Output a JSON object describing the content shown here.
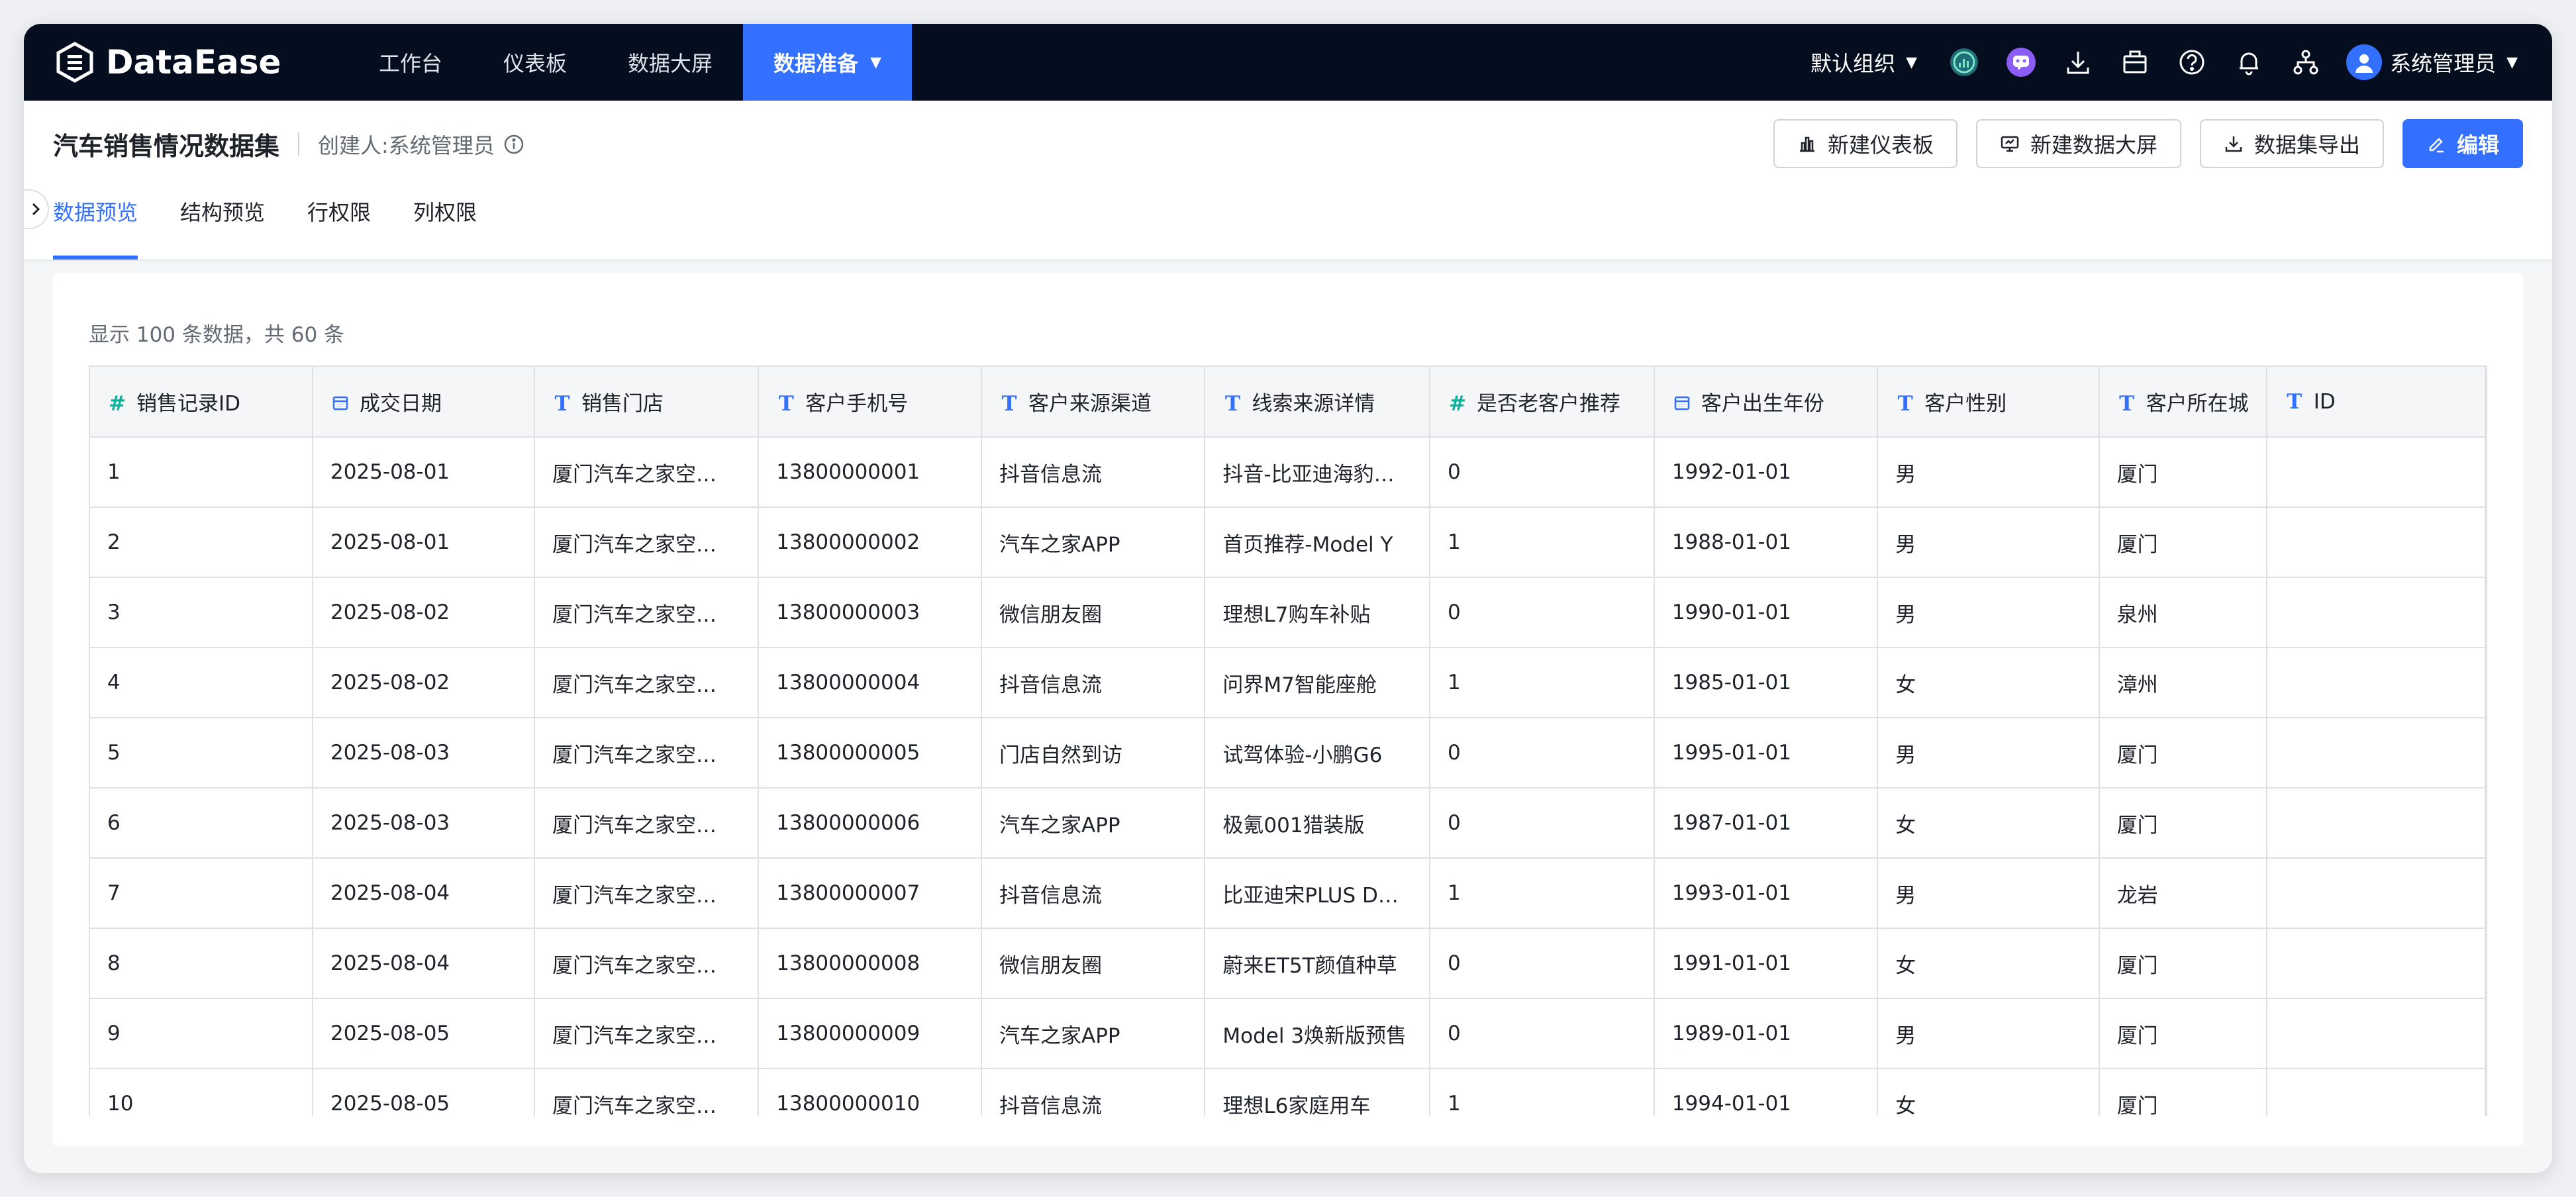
{
  "app": {
    "name": "DataEase"
  },
  "nav": {
    "items": [
      "工作台",
      "仪表板",
      "数据大屏"
    ],
    "active": "数据准备"
  },
  "topbar": {
    "org": "默认组织",
    "user": "系统管理员"
  },
  "header": {
    "title": "汽车销售情况数据集",
    "creator": "创建人:系统管理员",
    "actions": {
      "new_dashboard": "新建仪表板",
      "new_screen": "新建数据大屏",
      "export": "数据集导出",
      "edit": "编辑"
    },
    "tabs": [
      "数据预览",
      "结构预览",
      "行权限",
      "列权限"
    ]
  },
  "preview": {
    "count_text": "显示 100 条数据，共 60 条"
  },
  "table": {
    "columns": [
      {
        "label": "销售记录ID",
        "type": "number"
      },
      {
        "label": "成交日期",
        "type": "date"
      },
      {
        "label": "销售门店",
        "type": "text"
      },
      {
        "label": "客户手机号",
        "type": "text"
      },
      {
        "label": "客户来源渠道",
        "type": "text"
      },
      {
        "label": "线索来源详情",
        "type": "text"
      },
      {
        "label": "是否老客户推荐",
        "type": "number"
      },
      {
        "label": "客户出生年份",
        "type": "date"
      },
      {
        "label": "客户性别",
        "type": "text"
      },
      {
        "label": "客户所在城",
        "type": "text"
      },
      {
        "label": "ID",
        "type": "text"
      }
    ],
    "rows": [
      [
        "1",
        "2025-08-01",
        "厦门汽车之家空…",
        "13800000001",
        "抖音信息流",
        "抖音-比亚迪海豹…",
        "0",
        "1992-01-01",
        "男",
        "厦门",
        ""
      ],
      [
        "2",
        "2025-08-01",
        "厦门汽车之家空…",
        "13800000002",
        "汽车之家APP",
        "首页推荐-Model Y",
        "1",
        "1988-01-01",
        "男",
        "厦门",
        ""
      ],
      [
        "3",
        "2025-08-02",
        "厦门汽车之家空…",
        "13800000003",
        "微信朋友圈",
        "理想L7购车补贴",
        "0",
        "1990-01-01",
        "男",
        "泉州",
        ""
      ],
      [
        "4",
        "2025-08-02",
        "厦门汽车之家空…",
        "13800000004",
        "抖音信息流",
        "问界M7智能座舱",
        "1",
        "1985-01-01",
        "女",
        "漳州",
        ""
      ],
      [
        "5",
        "2025-08-03",
        "厦门汽车之家空…",
        "13800000005",
        "门店自然到访",
        "试驾体验-小鹏G6",
        "0",
        "1995-01-01",
        "男",
        "厦门",
        ""
      ],
      [
        "6",
        "2025-08-03",
        "厦门汽车之家空…",
        "13800000006",
        "汽车之家APP",
        "极氪001猎装版",
        "0",
        "1987-01-01",
        "女",
        "厦门",
        ""
      ],
      [
        "7",
        "2025-08-04",
        "厦门汽车之家空…",
        "13800000007",
        "抖音信息流",
        "比亚迪宋PLUS D…",
        "1",
        "1993-01-01",
        "男",
        "龙岩",
        ""
      ],
      [
        "8",
        "2025-08-04",
        "厦门汽车之家空…",
        "13800000008",
        "微信朋友圈",
        "蔚来ET5T颜值种草",
        "0",
        "1991-01-01",
        "女",
        "厦门",
        ""
      ],
      [
        "9",
        "2025-08-05",
        "厦门汽车之家空…",
        "13800000009",
        "汽车之家APP",
        "Model 3焕新版预售",
        "0",
        "1989-01-01",
        "男",
        "厦门",
        ""
      ],
      [
        "10",
        "2025-08-05",
        "厦门汽车之家空…",
        "13800000010",
        "抖音信息流",
        "理想L6家庭用车",
        "1",
        "1994-01-01",
        "女",
        "厦门",
        ""
      ]
    ]
  },
  "colors": {
    "primary": "#3370ff",
    "topbar": "#050e1f",
    "number_type": "#04b49c"
  }
}
